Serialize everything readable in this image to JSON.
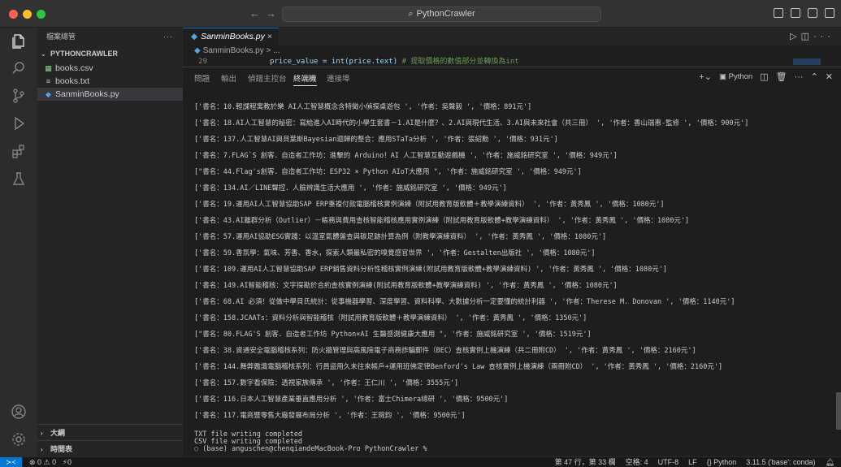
{
  "titlebar": {
    "search_text": "PythonCrawler",
    "back": "←",
    "forward": "→"
  },
  "sidebar": {
    "header": "檔案總管",
    "more": "···",
    "project": "PYTHONCRAWLER",
    "files": [
      {
        "name": "books.csv",
        "icon": "csv-file-icon"
      },
      {
        "name": "books.txt",
        "icon": "text-file-icon"
      },
      {
        "name": "SanminBooks.py",
        "icon": "python-file-icon"
      }
    ],
    "outline": "大綱",
    "timeline": "時間表"
  },
  "editor": {
    "tab_label": "SanminBooks.py",
    "close": "×",
    "breadcrumb": "SanminBooks.py > ...",
    "line_number": "29",
    "code_line": "price_value = int(price.text)",
    "code_comment": "# 提取價格的數值部分並轉換為int"
  },
  "panel": {
    "tabs": [
      "問題",
      "輸出",
      "偵錯主控台",
      "終端機",
      "連接埠"
    ],
    "active_tab": "終端機",
    "terminal_kind": "Python",
    "output_lines": [
      "['書名：10.輕課程寓教於樂 AI人工智慧概念含特徵小偵探桌遊包 ', '作者：吳聲毅 ', '價格：891元']",
      "['書名：18.AI人工智慧的秘密：寫給進入AI時代的小學生套書－1.AI是什麼？、2.AI與現代生活、3.AI與未來社會（共三冊） ', '作者：香山瑞惠-監修 ', '價格：900元']",
      "['書名：137.人工智慧AI與貝葉斯Bayesian迴歸的整合：應用STaTa分析 ', '作者：張紹勳 ', '價格：931元']",
      "['書名：7.FLAG`S 創客．自造者工作坊：進擊的 Arduino！AI 人工智慧互動遊戲機 ', '作者：施威銘研究室 ', '價格：949元']",
      "[\"書名：44.Flag's創客．自造者工作坊：ESP32 × Python AIoT大應用 \", '作者：施威銘研究室 ', '價格：949元']",
      "['書名：134.AI／LINE聲控．人臉辨識生活大應用 ', '作者：施威銘研究室 ', '價格：949元']",
      "['書名：19.運用AI人工智慧協助SAP ERP重複付款電腦稽核實例演練（附試用教育版軟體＋教學演練資料） ', '作者：黃秀鳳 ', '價格：1080元']",
      "['書名：43.AI離群分析（Outlier）－帳務與費用查核智能稽核應用實例演練（附試用教育版軟體+教學演練資料） ', '作者：黃秀鳳 ', '價格：1080元']",
      "['書名：57.運用AI協助ESG實踐：以溫室氣體盤查與碳足跡計算為例（附教學演練資料） ', '作者：黃秀鳳 ', '價格：1080元']",
      "['書名：59.香氛學：氣味、芳香、香水，探索人類最私密的嗅覺感官世界 ', '作者：Gestalten出版社 ', '價格：1080元']",
      "['書名：109.運用AI人工智慧協助SAP ERP銷售資料分析性稽核實例演練(附試用教育版軟體+教學演練資料) ', '作者：黃秀鳳 ', '價格：1080元']",
      "['書名：149.AI智能稽核：文字探勘於合約查核實例演練(附試用教育版軟體+教學演練資料) ', '作者：黃秀鳳 ', '價格：1080元']",
      "['書名：68.AI 必須！從做中學貝氏統計：從事機器學習、深度學習、資料科學、大數據分析一定要懂的統計利器 ', '作者：Therese M. Donovan ', '價格：1140元']",
      "['書名：158.JCAATs：資料分析與智能稽核（附試用教育版軟體＋教學演練資料） ', '作者：黃秀鳳 ', '價格：1350元']",
      "[\"書名：80.FLAG'S 創客．自造者工作坊 Python×AI 生醫感測健康大應用 \", '作者：施威銘研究室 ', '價格：1519元']",
      "['書名：38.資通安全電腦稽核系列：防火牆管理與高風險電子商務詐騙郵件（BEC）查核實例上機演練（共二冊附CD） ', '作者：黃秀鳳 ', '價格：2160元']",
      "['書名：144.舞弊鑑識電腦稽核系列：行員盜用久未往來帳戶+運用班佛定律Benford's Law 查核實例上機演練（兩冊附CD） ', '作者：黃秀鳳 ', '價格：2160元']",
      "['書名：157.數字看保險：透視家族傳承 ', '作者：王仁川 ', '價格：3555元']",
      "['書名：116.日本人工智慧產業垂直應用分析 ', '作者：富士Chimera總研 ', '價格：9500元']",
      "['書名：117.電商暨零售大廠發展布局分析 ', '作者：王琬鈞 ', '價格：9500元']"
    ],
    "completion_lines": [
      "TXT file writing completed",
      "CSV file writing completed"
    ],
    "prompt": "(base) anguschen@chenqiandeMacBook-Pro PythonCrawler %"
  },
  "statusbar": {
    "problems": "⊗ 0 ⚠ 0",
    "ports": "⚡0",
    "cursor": "第 47 行，第 33 欄",
    "spaces": "空格: 4",
    "encoding": "UTF-8",
    "eol": "LF",
    "language": "{} Python",
    "interpreter": "3.11.5 ('base': conda)"
  },
  "colors": {
    "accent": "#0078d4",
    "python": "#4fa6e0",
    "csv": "#89d185"
  }
}
